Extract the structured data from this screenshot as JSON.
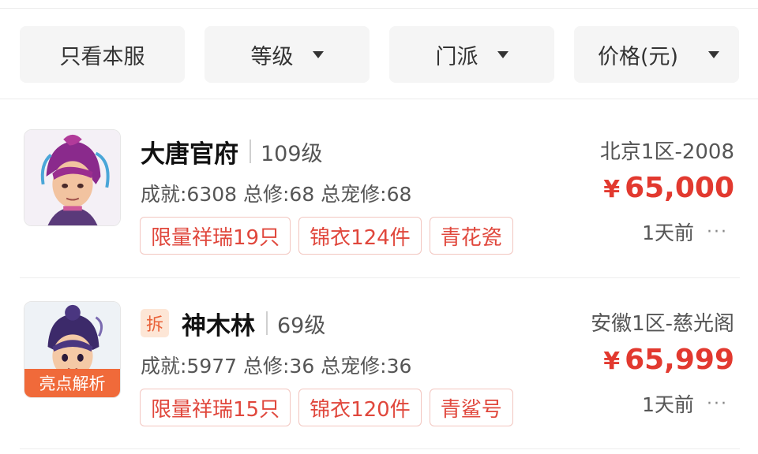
{
  "filters": [
    {
      "label": "只看本服"
    },
    {
      "label": "等级"
    },
    {
      "label": "门派"
    },
    {
      "label": "价格(元)"
    }
  ],
  "listings": [
    {
      "badge": "",
      "name": "大唐官府",
      "level": "109级",
      "stats": "成就:6308 总修:68 总宠修:68",
      "tags": [
        "限量祥瑞19只",
        "锦衣124件",
        "青花瓷"
      ],
      "server": "北京1区-2008",
      "currency": "¥",
      "price": "65,000",
      "time": "1天前",
      "more": "···"
    },
    {
      "badge": "拆",
      "avatar_tag": "亮点解析",
      "name": "神木林",
      "level": "69级",
      "stats": "成就:5977 总修:36 总宠修:36",
      "tags": [
        "限量祥瑞15只",
        "锦衣120件",
        "青鲨号"
      ],
      "server": "安徽1区-慈光阁",
      "currency": "¥",
      "price": "65,999",
      "time": "1天前",
      "more": "···"
    }
  ],
  "colors": {
    "price": "#e2392f",
    "tag_text": "#e0473c",
    "avatar_tag_bg": "#f06a3a",
    "badge_bg": "#fde6d6"
  },
  "icons": [
    "dropdown-caret-icon",
    "more-dots-icon"
  ]
}
